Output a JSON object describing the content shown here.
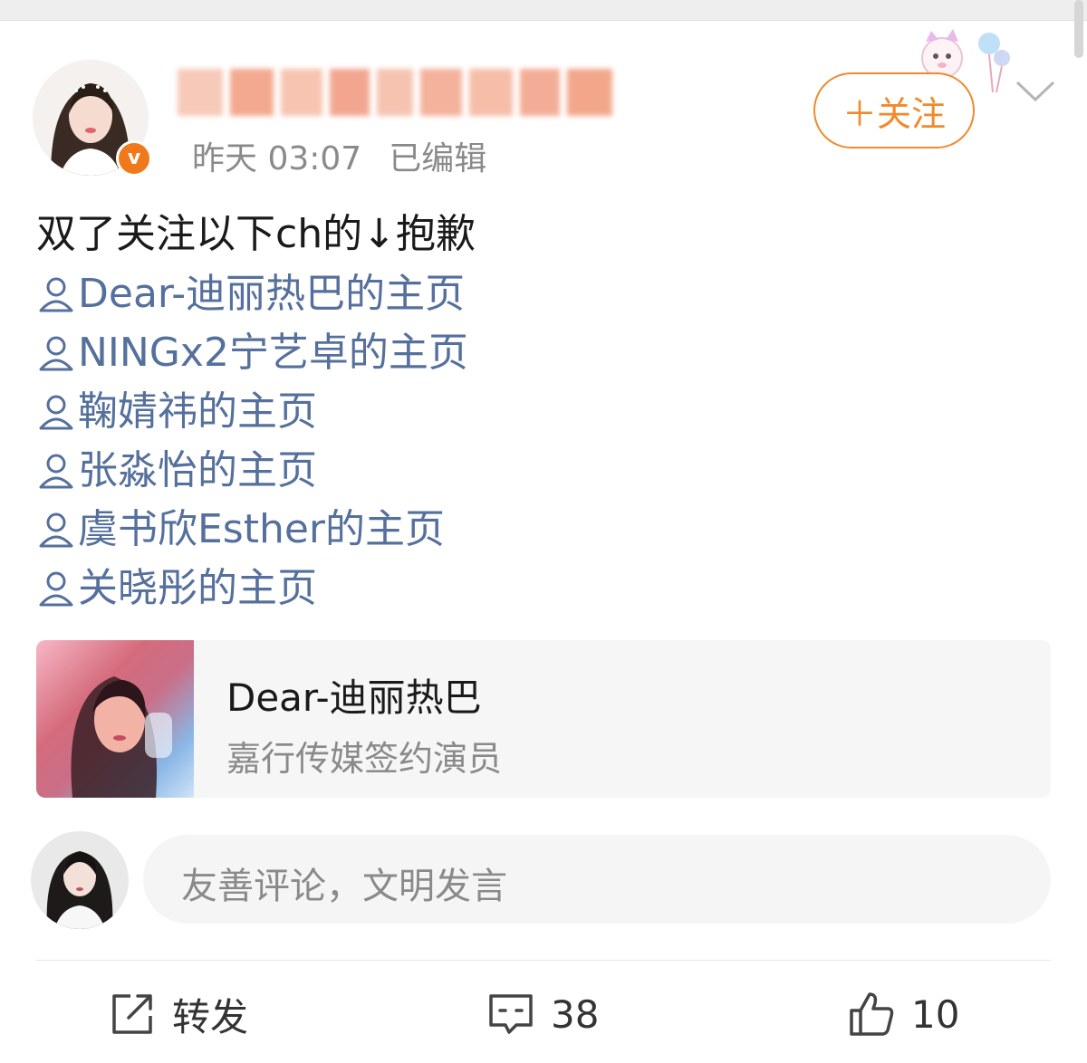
{
  "post": {
    "time": "昨天 03:07",
    "edited": "已编辑",
    "verified_badge": "v",
    "follow_label": "＋关注",
    "text": "双了关注以下ch的↓抱歉",
    "mentions": [
      "Dear-迪丽热巴的主页",
      "NINGx2宁艺卓的主页",
      "鞠婧祎的主页",
      "张淼怡的主页",
      "虞书欣Esther的主页",
      "关晓彤的主页"
    ]
  },
  "card": {
    "title": "Dear-迪丽热巴",
    "subtitle": "嘉行传媒签约演员"
  },
  "comment": {
    "placeholder": "友善评论，文明发言"
  },
  "actions": {
    "repost_label": "转发",
    "comment_count": "38",
    "like_count": "10"
  },
  "colors": {
    "accent": "#f08a2c",
    "link": "#55709c"
  }
}
